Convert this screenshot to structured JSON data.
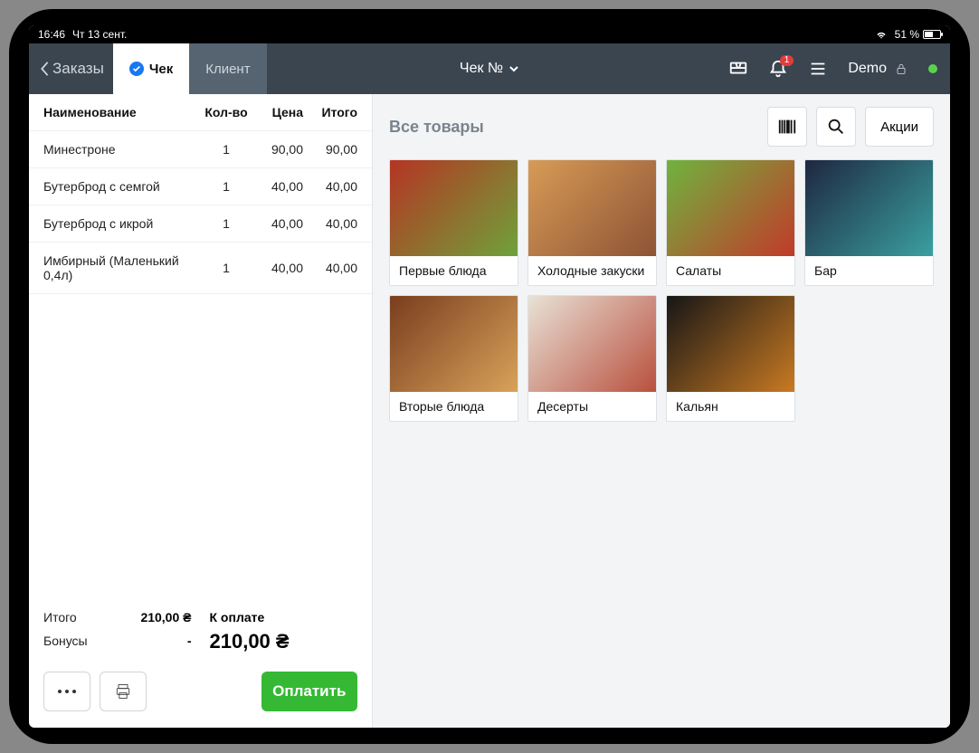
{
  "statusbar": {
    "time": "16:46",
    "date": "Чт 13 сент.",
    "battery_pct": "51 %"
  },
  "topbar": {
    "back_label": "Заказы",
    "tabs": {
      "check": "Чек",
      "client": "Клиент"
    },
    "title": "Чек №",
    "notification_count": "1",
    "user": "Demo"
  },
  "receipt": {
    "headers": {
      "name": "Наименование",
      "qty": "Кол-во",
      "price": "Цена",
      "total": "Итого"
    },
    "items": [
      {
        "name": "Минестроне",
        "qty": "1",
        "price": "90,00",
        "total": "90,00"
      },
      {
        "name": "Бутерброд с семгой",
        "qty": "1",
        "price": "40,00",
        "total": "40,00"
      },
      {
        "name": "Бутерброд с икрой",
        "qty": "1",
        "price": "40,00",
        "total": "40,00"
      },
      {
        "name": "Имбирный (Маленький 0,4л)",
        "qty": "1",
        "price": "40,00",
        "total": "40,00"
      }
    ],
    "summary": {
      "total_label": "Итого",
      "total_value": "210,00 ₴",
      "bonus_label": "Бонусы",
      "bonus_value": "-",
      "to_pay_label": "К оплате",
      "to_pay_value": "210,00 ₴",
      "pay_button": "Оплатить"
    }
  },
  "catalog": {
    "title": "Все товары",
    "promo_label": "Акции",
    "categories": [
      {
        "label": "Первые блюда"
      },
      {
        "label": "Холодные закуски"
      },
      {
        "label": "Салаты"
      },
      {
        "label": "Бар"
      },
      {
        "label": "Вторые блюда"
      },
      {
        "label": "Десерты"
      },
      {
        "label": "Кальян"
      }
    ]
  }
}
